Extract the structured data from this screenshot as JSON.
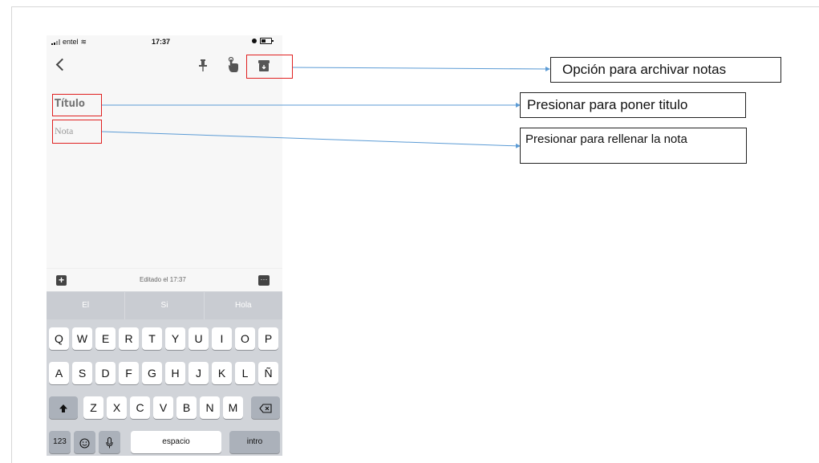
{
  "status_bar": {
    "carrier": "entel",
    "wifi_icon": "wifi-icon",
    "time": "17:37"
  },
  "toolbar": {
    "back_icon": "chevron-left-icon",
    "pin_icon": "pin-icon",
    "touch_icon": "touch-icon",
    "archive_icon": "archive-icon"
  },
  "note": {
    "title_placeholder": "Título",
    "body_placeholder": "Nota"
  },
  "bottom_bar": {
    "edited_label": "Editado el 17:37",
    "add_icon": "+",
    "more_icon": "···"
  },
  "keyboard": {
    "suggestions": [
      "El",
      "Si",
      "Hola"
    ],
    "row1": [
      "Q",
      "W",
      "E",
      "R",
      "T",
      "Y",
      "U",
      "I",
      "O",
      "P"
    ],
    "row2": [
      "A",
      "S",
      "D",
      "F",
      "G",
      "H",
      "J",
      "K",
      "L",
      "Ñ"
    ],
    "row3": [
      "Z",
      "X",
      "C",
      "V",
      "B",
      "N",
      "M"
    ],
    "numbers_key": "123",
    "space_key": "espacio",
    "return_key": "intro"
  },
  "annotations": {
    "archive": "Opción para archivar notas",
    "title": "Presionar para poner titulo",
    "note": "Presionar para rellenar la nota"
  },
  "colors": {
    "highlight_box": "#e02020",
    "arrow": "#5b9bd5"
  }
}
